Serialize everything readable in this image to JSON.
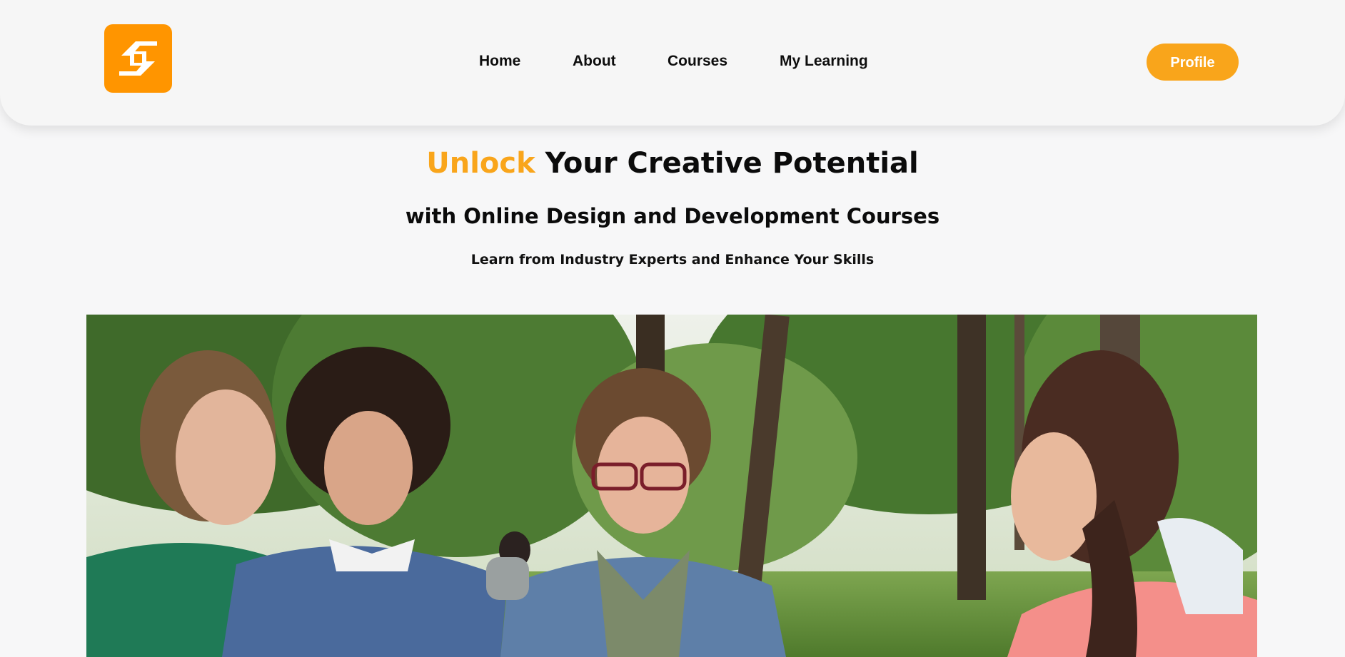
{
  "header": {
    "logo": {
      "icon": "s-logo-icon",
      "color": "#ff9500"
    },
    "nav": [
      {
        "label": "Home"
      },
      {
        "label": "About"
      },
      {
        "label": "Courses"
      },
      {
        "label": "My Learning"
      }
    ],
    "profile_label": "Profile",
    "profile_color": "#f9a51b"
  },
  "hero": {
    "title_accent": "Unlock",
    "title_rest": " Your Creative Potential",
    "subtitle": "with Online Design and Development Courses",
    "tagline": "Learn from Industry Experts and Enhance Your Skills",
    "accent_color": "#f9a51b"
  },
  "hero_image": {
    "subject": "four young people talking outdoors in a park"
  }
}
